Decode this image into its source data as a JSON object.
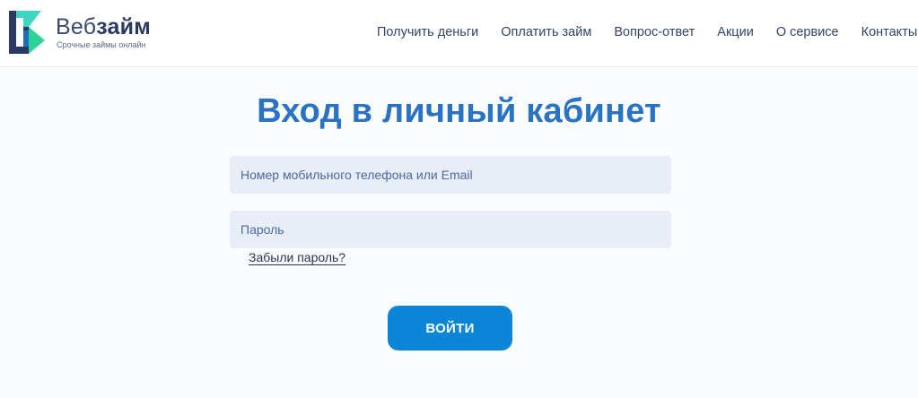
{
  "header": {
    "logo": {
      "name_regular": "Веб",
      "name_bold": "займ",
      "tagline": "Срочные займы онлайн"
    },
    "nav": [
      {
        "label": "Получить деньги"
      },
      {
        "label": "Оплатить займ"
      },
      {
        "label": "Вопрос-ответ"
      },
      {
        "label": "Акции"
      },
      {
        "label": "О сервисе"
      },
      {
        "label": "Контакты"
      }
    ]
  },
  "login": {
    "title": "Вход в личный кабинет",
    "login_placeholder": "Номер мобильного телефона или Email",
    "password_placeholder": "Пароль",
    "forgot_label": "Забыли пароль?",
    "submit_label": "ВОЙТИ"
  },
  "colors": {
    "title": "#2a72c4",
    "button": "#0b86d6",
    "field_bg": "#e9eef6",
    "logo_green": "#2fd39a",
    "logo_navy": "#2b3a62"
  }
}
